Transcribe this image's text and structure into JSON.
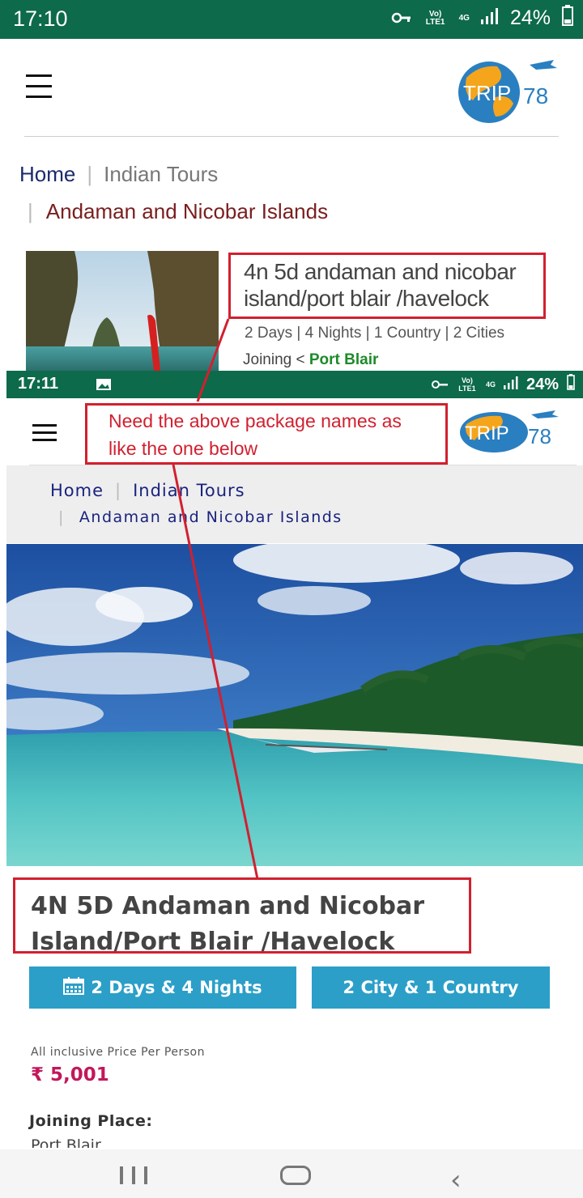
{
  "top_screen": {
    "status_bar": {
      "time": "17:10",
      "network": "Vo) LTE1",
      "signal": "4G",
      "battery": "24%"
    },
    "logo": {
      "text": "TRIP",
      "number": "78"
    },
    "breadcrumb": {
      "home": "Home",
      "section": "Indian Tours",
      "current": "Andaman and Nicobar Islands"
    },
    "package_card": {
      "title": "4n 5d andaman and nicobar island/port blair /havelock",
      "meta": "2 Days |  4 Nights |  1 Country | 2 Cities",
      "joining_label": "Joining <",
      "joining_place": "Port Blair"
    }
  },
  "annotation": {
    "note": "Need the above package names as like the one below"
  },
  "bottom_screen": {
    "status_bar": {
      "time": "17:11",
      "network": "Vo) LTE1",
      "signal": "4G",
      "battery": "24%"
    },
    "logo": {
      "text": "TRIP",
      "number": "78"
    },
    "breadcrumb": {
      "home": "Home",
      "section": "Indian Tours",
      "current": "Andaman and Nicobar Islands"
    },
    "title_line1": "4N 5D Andaman and Nicobar",
    "title_line2": "Island/Port Blair /Havelock",
    "btn_duration": "2 Days & 4 Nights",
    "btn_location": "2 City & 1 Country",
    "price_label": "All inclusive Price Per Person",
    "price": "₹ 5,001",
    "joining_label": "Joining Place:",
    "joining_value": "Port Blair"
  },
  "colors": {
    "status_bar": "#0d6a4a",
    "accent_button": "#2b9fc8",
    "annotation_red": "#d1202f",
    "price": "#c2185b"
  }
}
